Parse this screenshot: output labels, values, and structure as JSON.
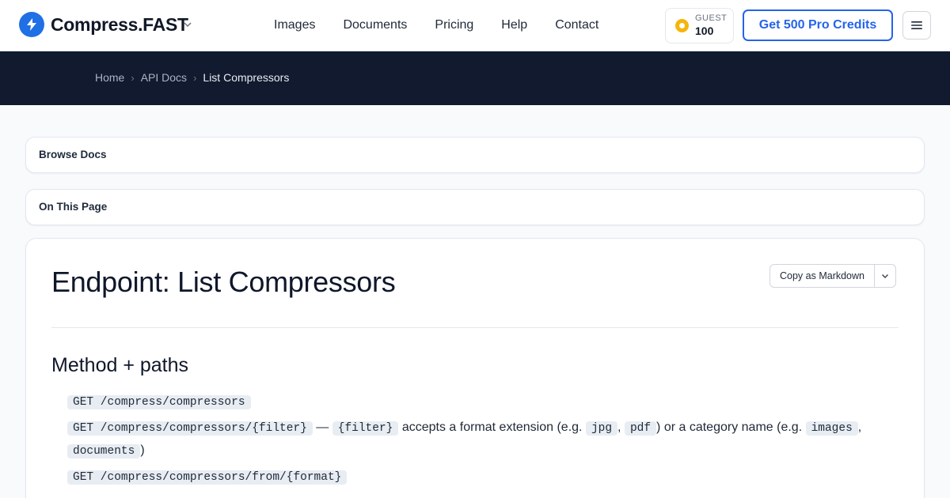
{
  "header": {
    "brand": "Compress.FAST",
    "nav": [
      "Images",
      "Documents",
      "Pricing",
      "Help",
      "Contact"
    ],
    "credits_label": "GUEST",
    "credits_value": "100",
    "cta": "Get 500 Pro Credits",
    "accent": "#2563eb"
  },
  "breadcrumb": {
    "items": [
      "Home",
      "API Docs"
    ],
    "current": "List Compressors"
  },
  "panels": {
    "browse": "Browse Docs",
    "toc": "On This Page"
  },
  "doc": {
    "title": "Endpoint: List Compressors",
    "copy_label": "Copy as Markdown",
    "section": "Method + paths",
    "line1_code": "GET /compress/compressors",
    "line2_code": "GET /compress/compressors/{filter}",
    "line2_dash": " — ",
    "line2_param": "{filter}",
    "line2_text_a": " accepts a format extension (e.g. ",
    "line2_ex1": "jpg",
    "line2_comma1": ", ",
    "line2_ex2": "pdf",
    "line2_text_b": ") or a category name (e.g. ",
    "line2_ex3": "images",
    "line2_comma2": ", ",
    "line2_ex4": "documents",
    "line2_close": ")",
    "line3_code": "GET /compress/compressors/from/{format}"
  }
}
